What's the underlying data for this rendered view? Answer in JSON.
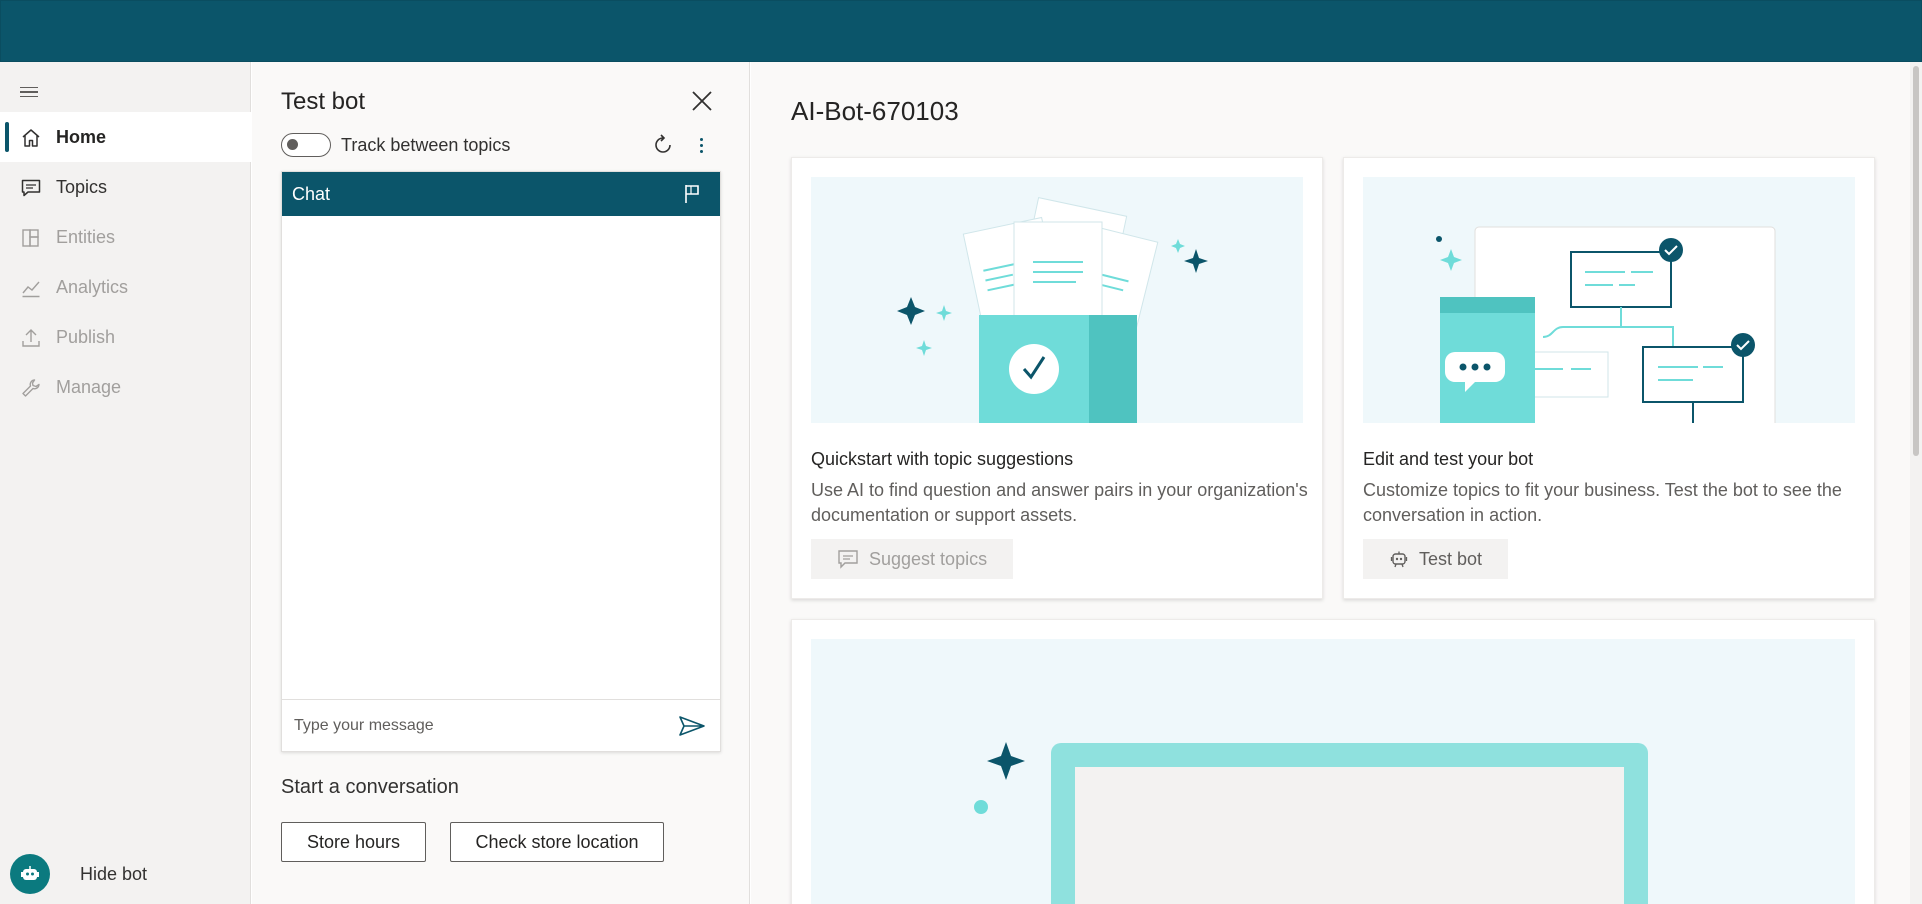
{
  "nav": {
    "items": [
      {
        "label": "Home",
        "icon": "home-icon",
        "state": "active"
      },
      {
        "label": "Topics",
        "icon": "chat-icon",
        "state": "normal"
      },
      {
        "label": "Entities",
        "icon": "entities-icon",
        "state": "disabled"
      },
      {
        "label": "Analytics",
        "icon": "analytics-icon",
        "state": "disabled"
      },
      {
        "label": "Publish",
        "icon": "publish-icon",
        "state": "disabled"
      },
      {
        "label": "Manage",
        "icon": "wrench-icon",
        "state": "disabled"
      }
    ],
    "hide_bot_label": "Hide bot"
  },
  "test_bot": {
    "title": "Test bot",
    "track_label": "Track between topics",
    "track_enabled": false,
    "chat_header": "Chat",
    "input_placeholder": "Type your message",
    "start_title": "Start a conversation",
    "suggestions": [
      "Store hours",
      "Check store location"
    ]
  },
  "main": {
    "bot_name": "AI-Bot-670103",
    "cards": [
      {
        "title": "Quickstart with topic suggestions",
        "description": "Use AI to find question and answer pairs in your organization's documentation or support assets.",
        "button": "Suggest topics",
        "button_enabled": false
      },
      {
        "title": "Edit and test your bot",
        "description": "Customize topics to fit your business. Test the bot to see the conversation in action.",
        "button": "Test bot",
        "button_enabled": true
      }
    ]
  },
  "colors": {
    "brand": "#0b556a",
    "accent_teal": "#6fdcd9",
    "illustration_bg": "#eff8fb"
  }
}
